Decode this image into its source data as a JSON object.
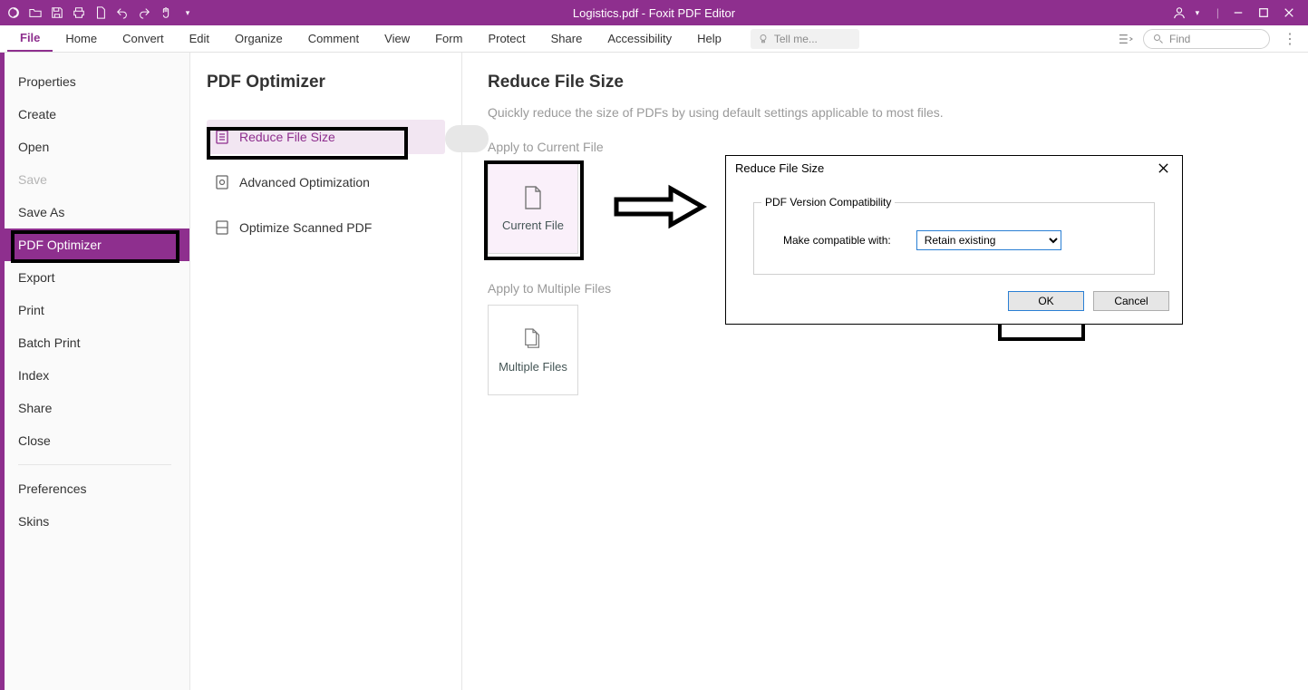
{
  "title": "Logistics.pdf - Foxit PDF Editor",
  "ribbon_tabs": [
    "File",
    "Home",
    "Convert",
    "Edit",
    "Organize",
    "Comment",
    "View",
    "Form",
    "Protect",
    "Share",
    "Accessibility",
    "Help"
  ],
  "tellme_placeholder": "Tell me...",
  "find_placeholder": "Find",
  "file_menu": {
    "items": [
      "Properties",
      "Create",
      "Open",
      "Save",
      "Save As",
      "PDF Optimizer",
      "Export",
      "Print",
      "Batch Print",
      "Index",
      "Share",
      "Close"
    ],
    "disabled_index": 3,
    "selected_index": 5,
    "footer_items": [
      "Preferences",
      "Skins"
    ]
  },
  "mid": {
    "heading": "PDF Optimizer",
    "options": [
      "Reduce File Size",
      "Advanced Optimization",
      "Optimize Scanned PDF"
    ],
    "selected_index": 0
  },
  "right": {
    "heading": "Reduce File Size",
    "desc": "Quickly reduce the size of PDFs by using default settings applicable to most files.",
    "section_current": "Apply to Current File",
    "tile_current": "Current File",
    "section_multiple": "Apply to Multiple Files",
    "tile_multiple": "Multiple Files"
  },
  "dialog": {
    "title": "Reduce File Size",
    "group_label": "PDF Version Compatibility",
    "field_label": "Make compatible with:",
    "select_value": "Retain existing",
    "ok": "OK",
    "cancel": "Cancel"
  }
}
